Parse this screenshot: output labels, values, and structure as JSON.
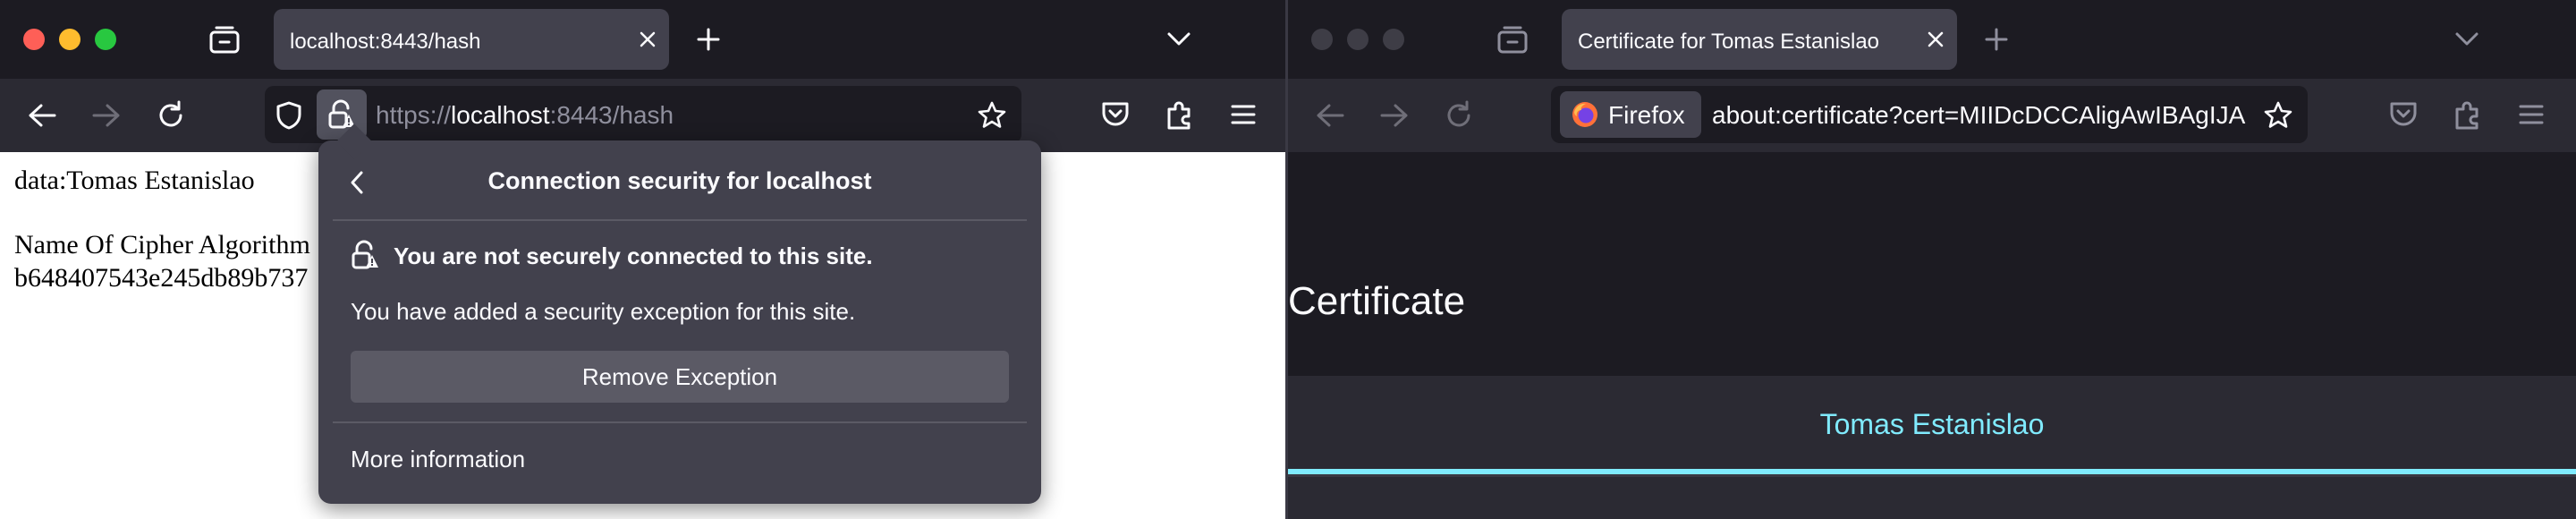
{
  "left_window": {
    "tab": {
      "title": "localhost:8443/hash"
    },
    "url": {
      "scheme": "https://",
      "host": "localhost",
      "rest": ":8443/hash"
    },
    "page_lines": [
      "data:Tomas Estanislao",
      "Name Of Cipher Algorithm",
      "b648407543e245db89b737"
    ],
    "security_popup": {
      "title": "Connection security for localhost",
      "warning": "You are not securely connected to this site.",
      "description": "You have added a security exception for this site.",
      "remove_button": "Remove Exception",
      "more_info": "More information"
    }
  },
  "right_window": {
    "tab": {
      "title": "Certificate for Tomas Estanislao"
    },
    "identity_chip": "Firefox",
    "url": "about:certificate?cert=MIIDcDCCAligAwIBAgIJA",
    "page": {
      "heading": "Certificate",
      "cert_tab": "Tomas Estanislao"
    }
  },
  "colors": {
    "accent": "#80ebff",
    "chrome_dark": "#1c1b22",
    "toolbar": "#2b2a33",
    "popup_bg": "#42414d"
  }
}
